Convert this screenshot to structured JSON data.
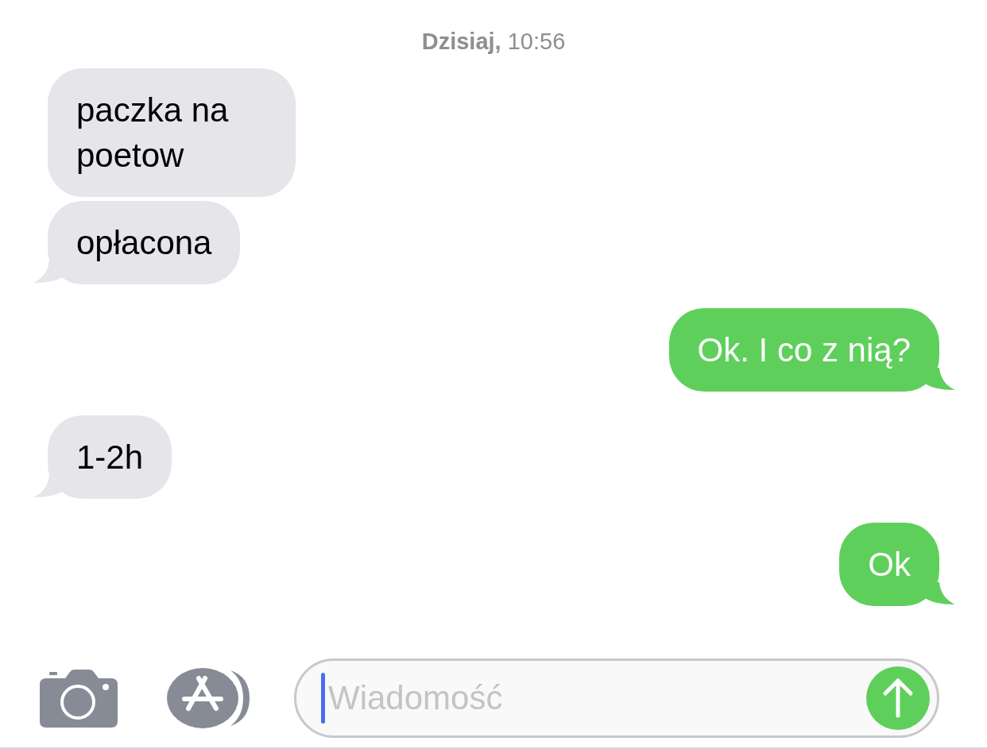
{
  "timestamp": {
    "day": "Dzisiaj,",
    "time": "10:56"
  },
  "messages": [
    {
      "kind": "received",
      "text": "paczka na poetow",
      "tail": false
    },
    {
      "kind": "received",
      "text": "opłacona",
      "tail": true
    },
    {
      "kind": "sent",
      "text": "Ok. I co z nią?",
      "tail": true
    },
    {
      "kind": "received",
      "text": "1-2h",
      "tail": true
    },
    {
      "kind": "sent",
      "text": "Ok",
      "tail": true
    }
  ],
  "composer": {
    "placeholder": "Wiadomość"
  }
}
